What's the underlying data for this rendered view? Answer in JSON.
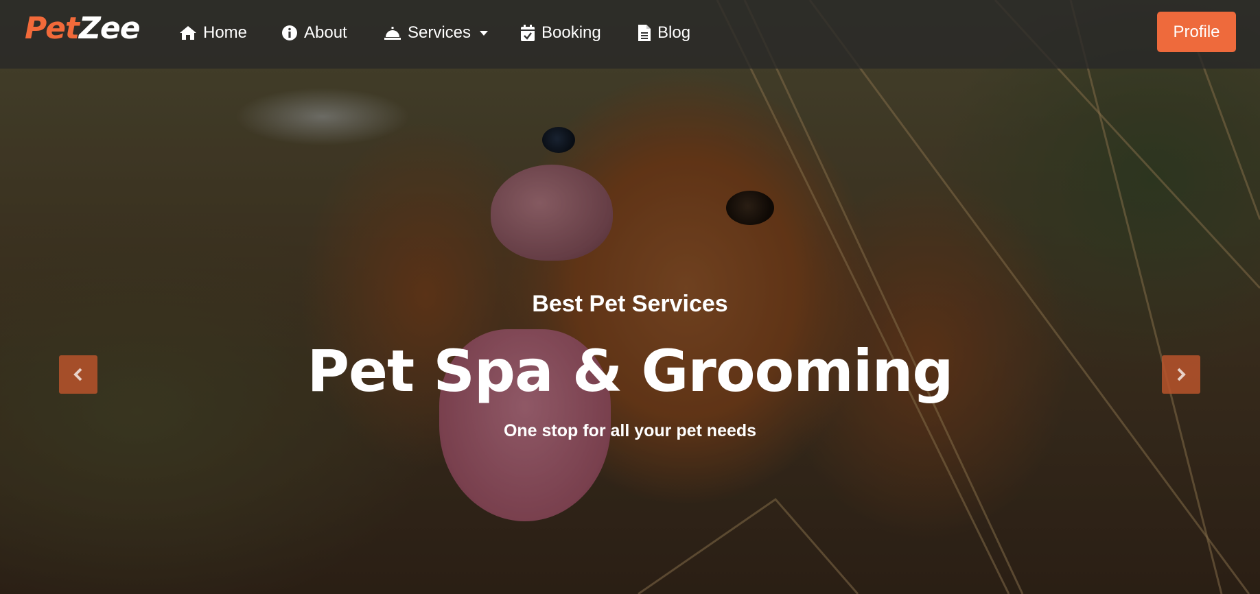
{
  "brand": {
    "part1": "Pet",
    "part2": "Zee",
    "accent_color": "#f26a3a"
  },
  "nav": {
    "items": [
      {
        "label": "Home",
        "icon": "home-icon"
      },
      {
        "label": "About",
        "icon": "info-icon"
      },
      {
        "label": "Services",
        "icon": "bell-service-icon",
        "has_dropdown": true
      },
      {
        "label": "Booking",
        "icon": "calendar-check-icon"
      },
      {
        "label": "Blog",
        "icon": "document-icon"
      }
    ],
    "profile_label": "Profile"
  },
  "hero": {
    "kicker": "Best Pet Services",
    "title": "Pet Spa & Grooming",
    "subtitle": "One stop for all your pet needs",
    "prev_icon": "chevron-left-icon",
    "next_icon": "chevron-right-icon"
  },
  "colors": {
    "accent": "#ee6a3c",
    "navbar_bg": "rgba(40,40,40,0.78)",
    "text": "#ffffff"
  }
}
